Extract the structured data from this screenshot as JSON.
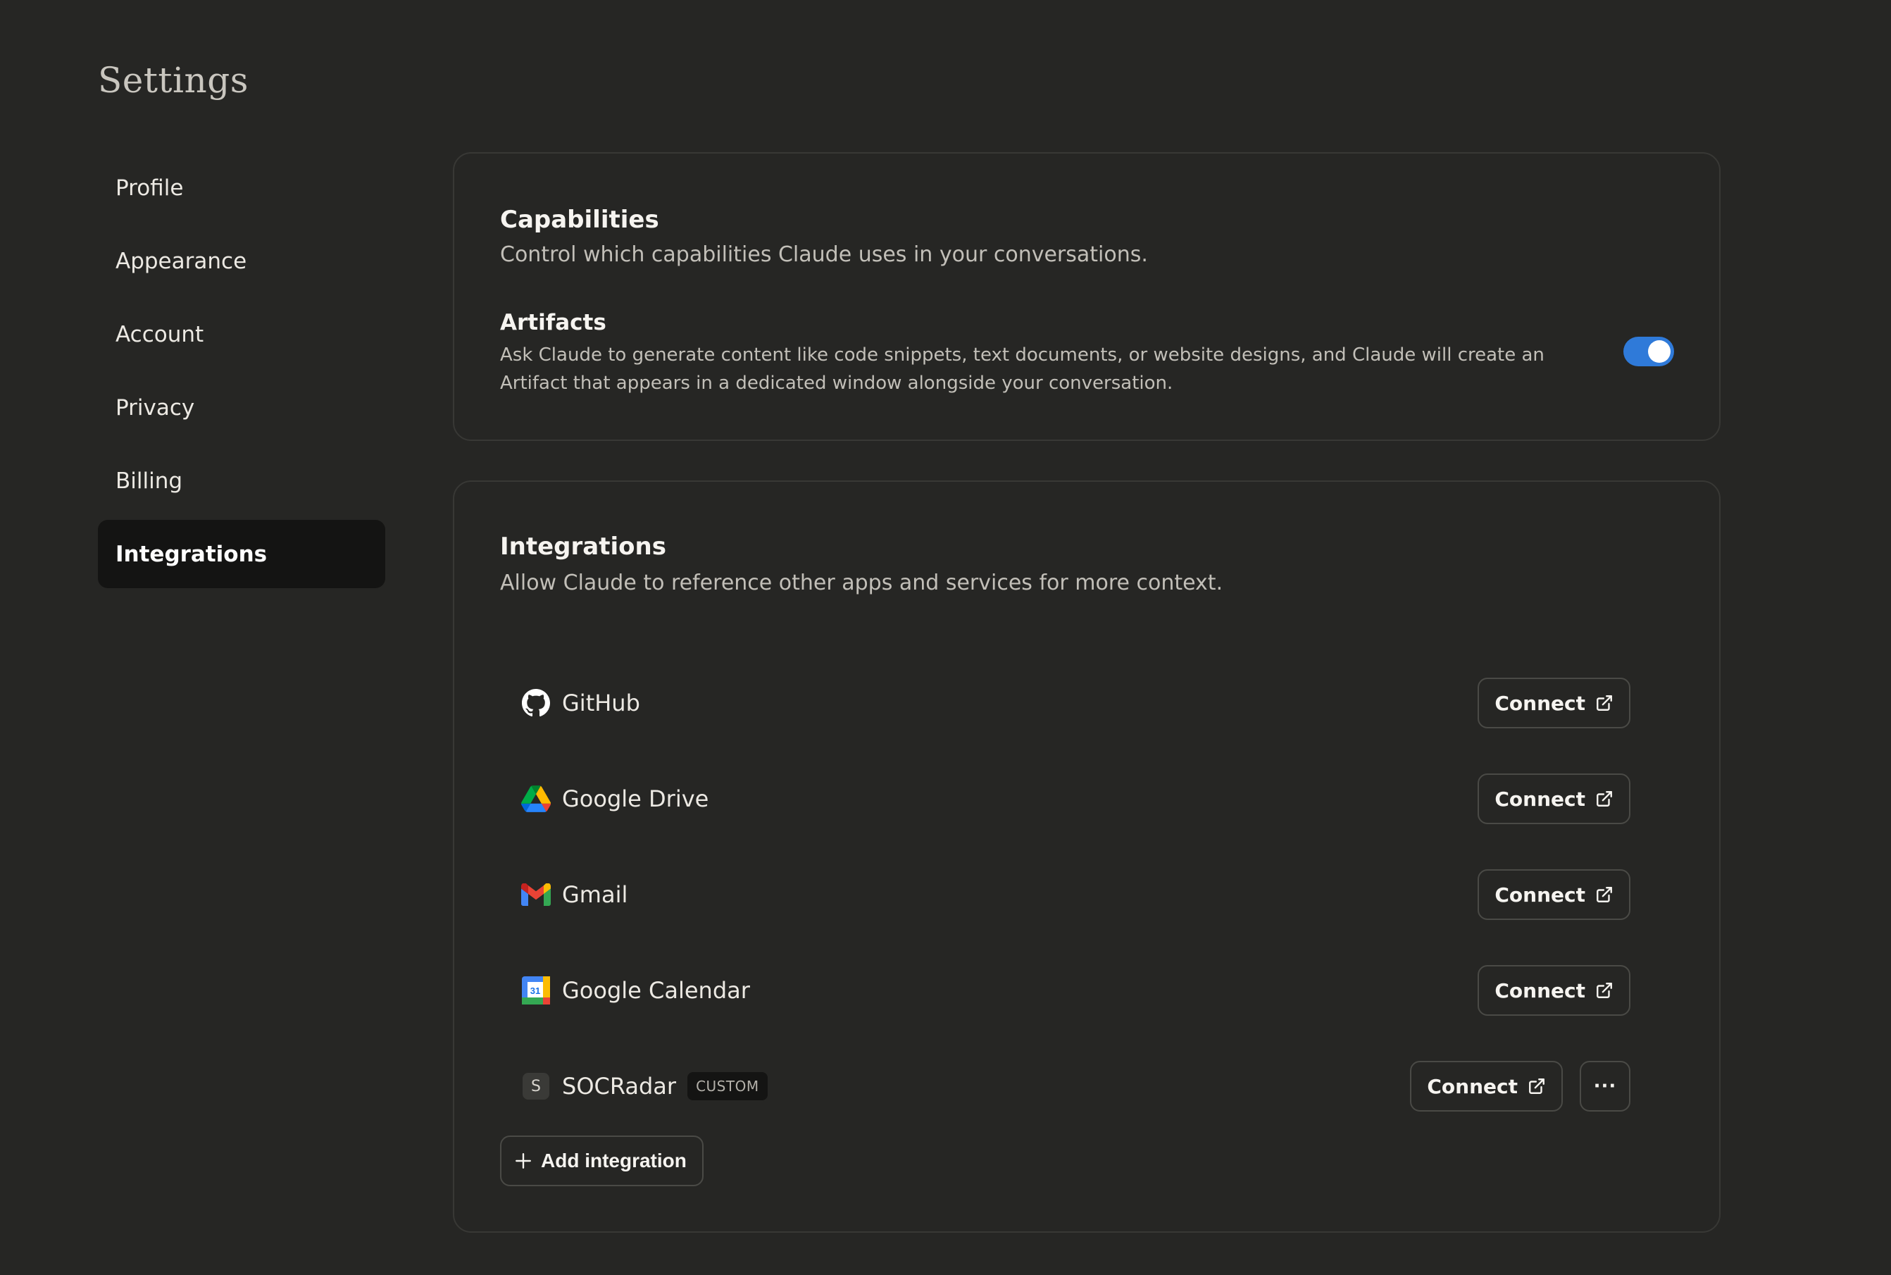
{
  "page": {
    "title": "Settings"
  },
  "sidebar": {
    "items": [
      {
        "label": "Profile",
        "active": false
      },
      {
        "label": "Appearance",
        "active": false
      },
      {
        "label": "Account",
        "active": false
      },
      {
        "label": "Privacy",
        "active": false
      },
      {
        "label": "Billing",
        "active": false
      },
      {
        "label": "Integrations",
        "active": true
      }
    ]
  },
  "capabilities": {
    "title": "Capabilities",
    "subtitle": "Control which capabilities Claude uses in your conversations.",
    "artifacts": {
      "title": "Artifacts",
      "description": "Ask Claude to generate content like code snippets, text documents, or website designs, and Claude will create an Artifact that appears in a dedicated window alongside your conversation.",
      "enabled": true,
      "toggle_color": "#2f7ad9"
    }
  },
  "integrations": {
    "title": "Integrations",
    "subtitle": "Allow Claude to reference other apps and services for more context.",
    "items": [
      {
        "name": "GitHub",
        "icon": "github-icon",
        "action": "Connect"
      },
      {
        "name": "Google Drive",
        "icon": "google-drive-icon",
        "action": "Connect"
      },
      {
        "name": "Gmail",
        "icon": "gmail-icon",
        "action": "Connect"
      },
      {
        "name": "Google Calendar",
        "icon": "google-calendar-icon",
        "icon_text": "31",
        "action": "Connect"
      },
      {
        "name": "SOCRadar",
        "icon": "letter-s-icon",
        "icon_text": "S",
        "badge": "CUSTOM",
        "action": "Connect",
        "more": "···"
      }
    ],
    "add_label": "Add integration"
  }
}
